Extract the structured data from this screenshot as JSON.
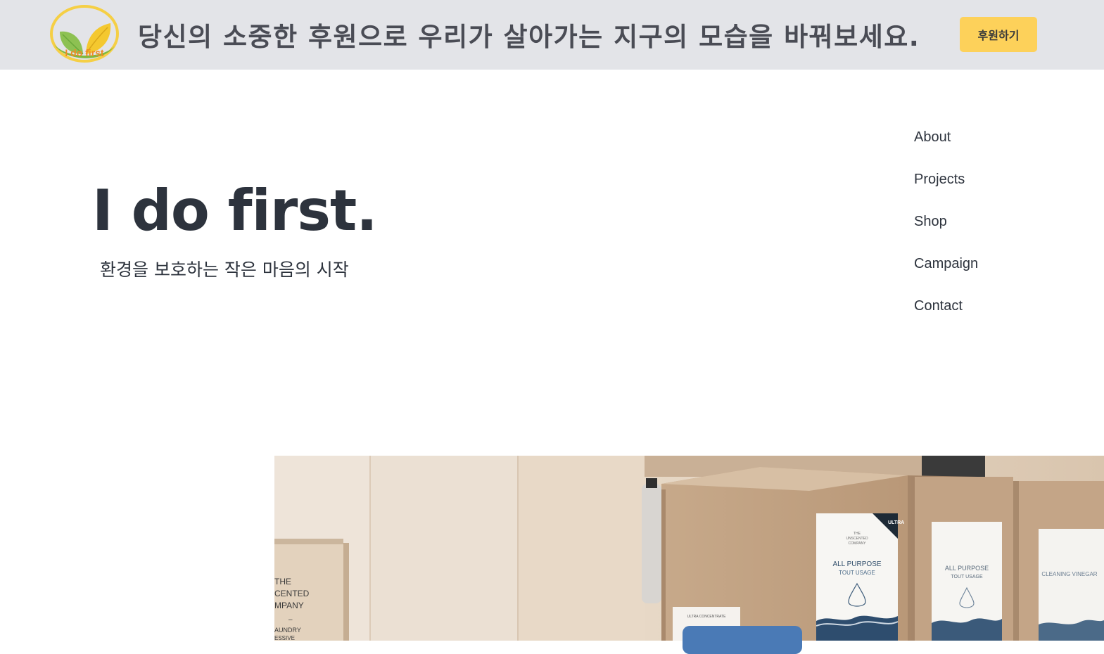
{
  "banner": {
    "logo_text": "I do first",
    "message": "당신의 소중한 후원으로 우리가 살아가는 지구의 모습을 바꿔보세요.",
    "donate_label": "후원하기",
    "background": "#e3e4e8",
    "button_color": "#fdd15a"
  },
  "hero": {
    "title": "I do first.",
    "subtitle": "환경을 보호하는 작은 마음의 시작"
  },
  "nav": {
    "items": [
      {
        "label": "About"
      },
      {
        "label": "Projects"
      },
      {
        "label": "Shop"
      },
      {
        "label": "Campaign"
      },
      {
        "label": "Contact"
      }
    ]
  },
  "photo": {
    "box_left_text": [
      "THE",
      "CENTED",
      "MPANY",
      "–",
      "AUNDRY",
      "ESSIVE"
    ],
    "box1_brand": [
      "THE",
      "UNSCENTED",
      "COMPANY"
    ],
    "box1_product": "ALL PURPOSE",
    "box1_sub": "TOUT USAGE",
    "box1_badge": "ULTRA",
    "box2_product": "ALL PURPOSE",
    "box2_sub": "TOUT USAGE",
    "box3_product": "CLEANING VINEGAR",
    "accent_button_color": "#4a7ab6"
  }
}
